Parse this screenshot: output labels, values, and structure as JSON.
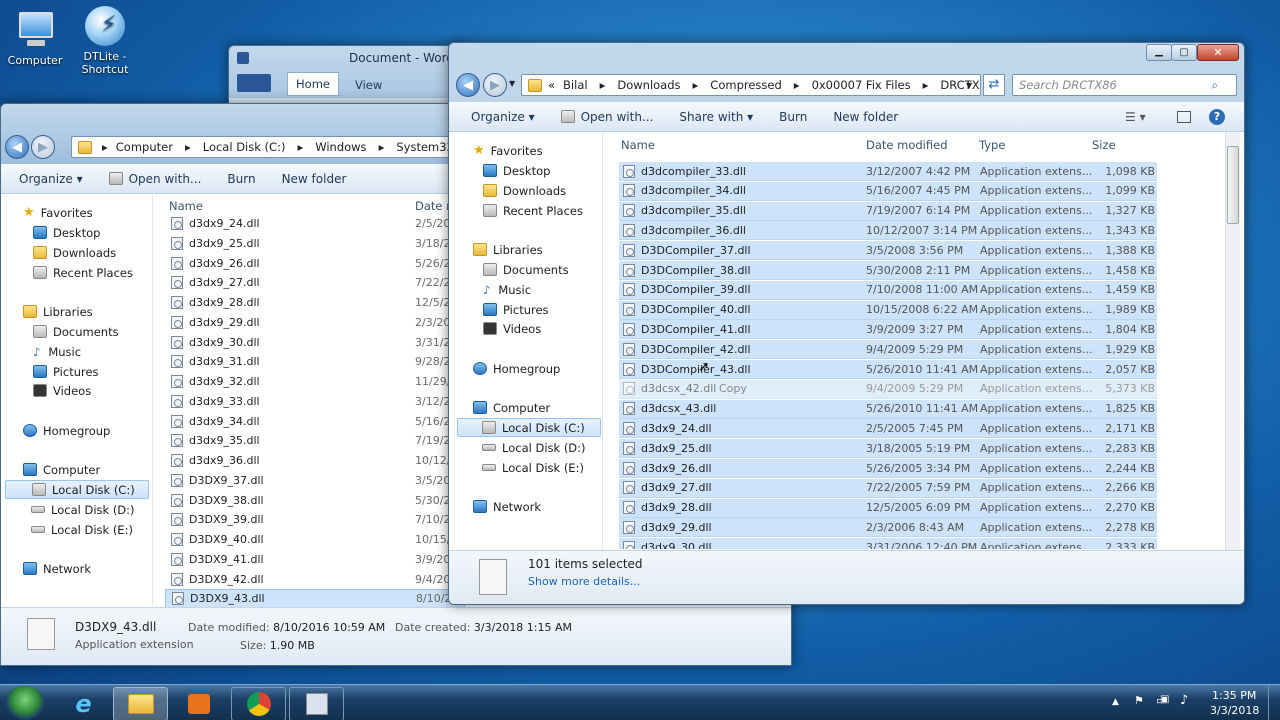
{
  "desktop": {
    "icons": [
      {
        "label": "Computer"
      },
      {
        "label": "DTLite - Shortcut"
      }
    ]
  },
  "word": {
    "title": "Document - WordP",
    "tabs": [
      "Home",
      "View"
    ]
  },
  "back": {
    "path": [
      "Computer",
      "Local Disk (C:)",
      "Windows",
      "System32"
    ],
    "toolbar": [
      "Organize ▾",
      "Open with...",
      "Burn",
      "New folder"
    ],
    "nav": {
      "favorites": "Favorites",
      "desktop": "Desktop",
      "downloads": "Downloads",
      "recent": "Recent Places",
      "libraries": "Libraries",
      "documents": "Documents",
      "music": "Music",
      "pictures": "Pictures",
      "videos": "Videos",
      "homegroup": "Homegroup",
      "computer": "Computer",
      "c": "Local Disk (C:)",
      "d": "Local Disk (D:)",
      "e": "Local Disk (E:)",
      "network": "Network"
    },
    "headers": {
      "name": "Name",
      "date": "Date m"
    },
    "files": [
      {
        "name": "d3dx9_24.dll",
        "date": "2/5/20"
      },
      {
        "name": "d3dx9_25.dll",
        "date": "3/18/2"
      },
      {
        "name": "d3dx9_26.dll",
        "date": "5/26/2"
      },
      {
        "name": "d3dx9_27.dll",
        "date": "7/22/2"
      },
      {
        "name": "d3dx9_28.dll",
        "date": "12/5/2"
      },
      {
        "name": "d3dx9_29.dll",
        "date": "2/3/20"
      },
      {
        "name": "d3dx9_30.dll",
        "date": "3/31/2"
      },
      {
        "name": "d3dx9_31.dll",
        "date": "9/28/2"
      },
      {
        "name": "d3dx9_32.dll",
        "date": "11/29/"
      },
      {
        "name": "d3dx9_33.dll",
        "date": "3/12/2"
      },
      {
        "name": "d3dx9_34.dll",
        "date": "5/16/2"
      },
      {
        "name": "d3dx9_35.dll",
        "date": "7/19/2"
      },
      {
        "name": "d3dx9_36.dll",
        "date": "10/12/"
      },
      {
        "name": "D3DX9_37.dll",
        "date": "3/5/20"
      },
      {
        "name": "D3DX9_38.dll",
        "date": "5/30/2"
      },
      {
        "name": "D3DX9_39.dll",
        "date": "7/10/2"
      },
      {
        "name": "D3DX9_40.dll",
        "date": "10/15/"
      },
      {
        "name": "D3DX9_41.dll",
        "date": "3/9/20"
      },
      {
        "name": "D3DX9_42.dll",
        "date": "9/4/20"
      },
      {
        "name": "D3DX9_43.dll",
        "date": "8/10/2"
      }
    ],
    "details": {
      "filename": "D3DX9_43.dll",
      "type": "Application extension",
      "modified_label": "Date modified:",
      "modified": "8/10/2016 10:59 AM",
      "size_label": "Size:",
      "size": "1.90 MB",
      "created_label": "Date created:",
      "created": "3/3/2018 1:15 AM"
    }
  },
  "front": {
    "path": [
      "«",
      "Bilal",
      "Downloads",
      "Compressed",
      "0x00007 Fix Files",
      "DRCTX86"
    ],
    "search_placeholder": "Search DRCTX86",
    "toolbar": [
      "Organize ▾",
      "Open with...",
      "Share with ▾",
      "Burn",
      "New folder"
    ],
    "nav": {
      "favorites": "Favorites",
      "desktop": "Desktop",
      "downloads": "Downloads",
      "recent": "Recent Places",
      "libraries": "Libraries",
      "documents": "Documents",
      "music": "Music",
      "pictures": "Pictures",
      "videos": "Videos",
      "homegroup": "Homegroup",
      "computer": "Computer",
      "c": "Local Disk (C:)",
      "d": "Local Disk (D:)",
      "e": "Local Disk (E:)",
      "network": "Network"
    },
    "headers": {
      "name": "Name",
      "date": "Date modified",
      "type": "Type",
      "size": "Size"
    },
    "files": [
      {
        "name": "d3dcompiler_33.dll",
        "date": "3/12/2007 4:42 PM",
        "type": "Application extens...",
        "size": "1,098 KB"
      },
      {
        "name": "d3dcompiler_34.dll",
        "date": "5/16/2007 4:45 PM",
        "type": "Application extens...",
        "size": "1,099 KB"
      },
      {
        "name": "d3dcompiler_35.dll",
        "date": "7/19/2007 6:14 PM",
        "type": "Application extens...",
        "size": "1,327 KB"
      },
      {
        "name": "d3dcompiler_36.dll",
        "date": "10/12/2007 3:14 PM",
        "type": "Application extens...",
        "size": "1,343 KB"
      },
      {
        "name": "D3DCompiler_37.dll",
        "date": "3/5/2008 3:56 PM",
        "type": "Application extens...",
        "size": "1,388 KB"
      },
      {
        "name": "D3DCompiler_38.dll",
        "date": "5/30/2008 2:11 PM",
        "type": "Application extens...",
        "size": "1,458 KB"
      },
      {
        "name": "D3DCompiler_39.dll",
        "date": "7/10/2008 11:00 AM",
        "type": "Application extens...",
        "size": "1,459 KB"
      },
      {
        "name": "D3DCompiler_40.dll",
        "date": "10/15/2008 6:22 AM",
        "type": "Application extens...",
        "size": "1,989 KB"
      },
      {
        "name": "D3DCompiler_41.dll",
        "date": "3/9/2009 3:27 PM",
        "type": "Application extens...",
        "size": "1,804 KB"
      },
      {
        "name": "D3DCompiler_42.dll",
        "date": "9/4/2009 5:29 PM",
        "type": "Application extens...",
        "size": "1,929 KB"
      },
      {
        "name": "D3DCompiler_43.dll",
        "date": "5/26/2010 11:41 AM",
        "type": "Application extens...",
        "size": "2,057 KB"
      },
      {
        "name": "d3dcsx_42.dll",
        "date": "9/4/2009 5:29 PM",
        "type": "Application extens...",
        "size": "5,373 KB"
      },
      {
        "name": "d3dcsx_43.dll",
        "date": "5/26/2010 11:41 AM",
        "type": "Application extens...",
        "size": "1,825 KB"
      },
      {
        "name": "d3dx9_24.dll",
        "date": "2/5/2005 7:45 PM",
        "type": "Application extens...",
        "size": "2,171 KB"
      },
      {
        "name": "d3dx9_25.dll",
        "date": "3/18/2005 5:19 PM",
        "type": "Application extens...",
        "size": "2,283 KB"
      },
      {
        "name": "d3dx9_26.dll",
        "date": "5/26/2005 3:34 PM",
        "type": "Application extens...",
        "size": "2,244 KB"
      },
      {
        "name": "d3dx9_27.dll",
        "date": "7/22/2005 7:59 PM",
        "type": "Application extens...",
        "size": "2,266 KB"
      },
      {
        "name": "d3dx9_28.dll",
        "date": "12/5/2005 6:09 PM",
        "type": "Application extens...",
        "size": "2,270 KB"
      },
      {
        "name": "d3dx9_29.dll",
        "date": "2/3/2006 8:43 AM",
        "type": "Application extens...",
        "size": "2,278 KB"
      },
      {
        "name": "d3dx9_30.dll",
        "date": "3/31/2006 12:40 PM",
        "type": "Application extens...",
        "size": "2,333 KB"
      }
    ],
    "drag_label": "Copy",
    "status": {
      "count": "101 items selected",
      "more": "Show more details..."
    }
  },
  "taskbar": {
    "time": "1:35 PM",
    "date": "3/3/2018"
  },
  "colors": {
    "selection": "#cde3f9",
    "taskbar": "#1b3f66"
  }
}
